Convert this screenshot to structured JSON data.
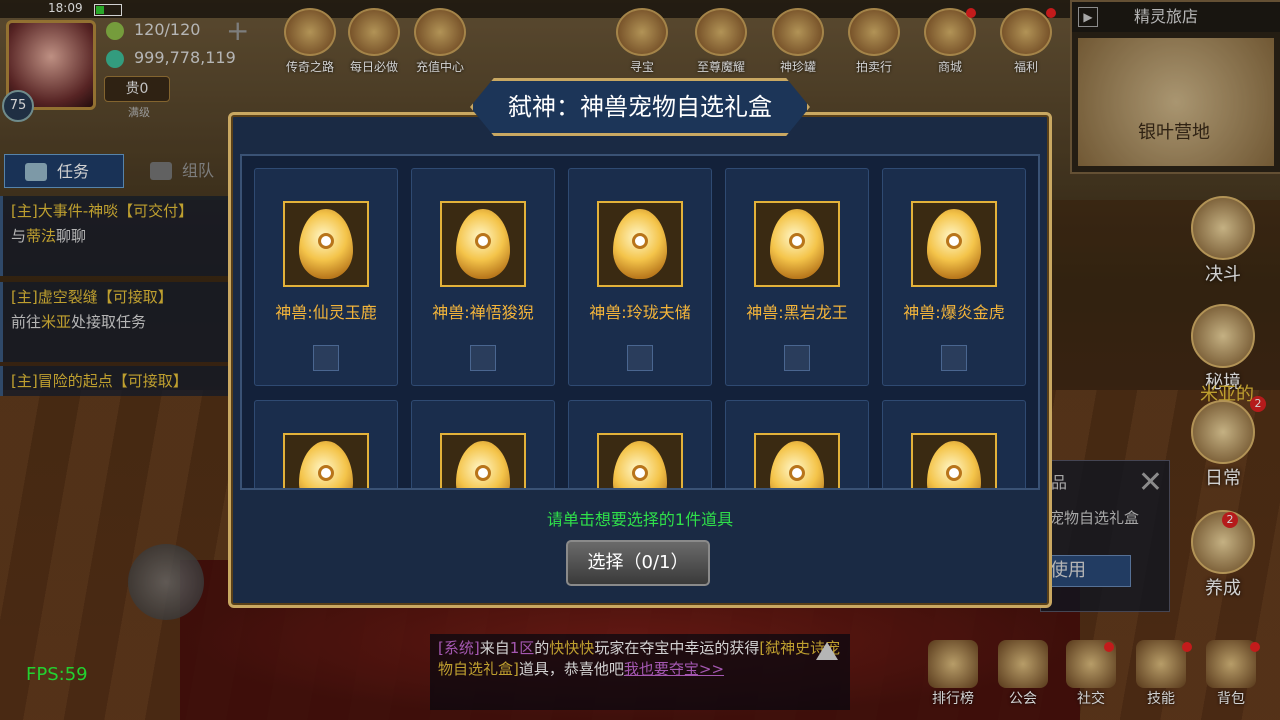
{
  "status": {
    "time": "18:09"
  },
  "player": {
    "level": "75",
    "stamina": "120/120",
    "gold": "999,778,119",
    "vip": "贵0",
    "vip_sub": "满级"
  },
  "top_icons": [
    {
      "label": "传奇之路"
    },
    {
      "label": "每日必做"
    },
    {
      "label": "充值中心"
    },
    {
      "label": "寻宝"
    },
    {
      "label": "至尊魔耀"
    },
    {
      "label": "神珍罐"
    },
    {
      "label": "拍卖行"
    },
    {
      "label": "商城"
    },
    {
      "label": "福利"
    }
  ],
  "minimap": {
    "title": "精灵旅店",
    "location": "银叶营地"
  },
  "tabs": [
    {
      "label": "任务"
    },
    {
      "label": "组队"
    }
  ],
  "tasks": [
    {
      "title": "[主]大事件-神啖【可交付】",
      "desc_pre": "与",
      "desc_hl": "蒂法",
      "desc_post": "聊聊"
    },
    {
      "title": "[主]虚空裂缝【可接取】",
      "desc_pre": "前往",
      "desc_hl": "米亚",
      "desc_post": "处接取任务"
    },
    {
      "title": "[主]冒险的起点【可接取】",
      "desc_pre": "",
      "desc_hl": "",
      "desc_post": ""
    }
  ],
  "right_buttons": [
    {
      "label": "决斗"
    },
    {
      "label": "秘境"
    },
    {
      "label": "日常",
      "badge": "2"
    },
    {
      "label": "养成",
      "badge": "2"
    }
  ],
  "right_npc_text": "米亚的",
  "behind_panel": {
    "pin": "品",
    "text": "宠物自选礼盒",
    "button": "使用",
    "close": "✕"
  },
  "dialog": {
    "title": "弑神：神兽宠物自选礼盒",
    "items": [
      {
        "name": "神兽:仙灵玉鹿"
      },
      {
        "name": "神兽:禅悟狻猊"
      },
      {
        "name": "神兽:玲珑夫储"
      },
      {
        "name": "神兽:黑岩龙王"
      },
      {
        "name": "神兽:爆炎金虎"
      },
      {
        "name": ""
      },
      {
        "name": ""
      },
      {
        "name": ""
      },
      {
        "name": ""
      },
      {
        "name": ""
      }
    ],
    "hint": "请单击想要选择的1件道具",
    "choose_button": "选择（0/1）"
  },
  "chat": {
    "sys": "[系统]",
    "part1": "来自",
    "zone": "1区",
    "part2": "的",
    "player": "快快快",
    "part3": "玩家在夺宝中幸运的获得",
    "item": "[弑神史诗宠物自选礼盒]",
    "part4": "道具，恭喜他吧",
    "link": "我也要夺宝>>"
  },
  "bottom_nav": [
    {
      "label": "排行榜"
    },
    {
      "label": "公会"
    },
    {
      "label": "社交"
    },
    {
      "label": "技能"
    },
    {
      "label": "背包"
    }
  ],
  "fps": "FPS:59"
}
